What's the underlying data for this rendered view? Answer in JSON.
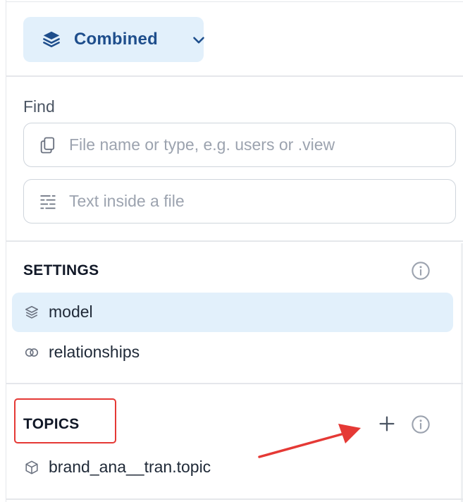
{
  "mode_selector": {
    "label": "Combined",
    "icon": "layers-icon",
    "chevron": "chevron-down-icon"
  },
  "find": {
    "label": "Find",
    "file_search": {
      "placeholder": "File name or type, e.g. users or .view",
      "value": "",
      "icon": "file-copy-icon"
    },
    "text_search": {
      "placeholder": "Text inside a file",
      "value": "",
      "icon": "text-lines-icon"
    }
  },
  "settings": {
    "title": "SETTINGS",
    "items": [
      {
        "label": "model",
        "icon": "layers-icon",
        "active": true
      },
      {
        "label": "relationships",
        "icon": "link-rings-icon",
        "active": false
      }
    ]
  },
  "topics": {
    "title": "TOPICS",
    "items": [
      {
        "label": "brand_ana__tran.topic",
        "icon": "cube-icon"
      }
    ]
  },
  "colors": {
    "accent_bg": "#e2f0fb",
    "accent_text": "#1e4e8c",
    "annotation": "#e53935"
  }
}
